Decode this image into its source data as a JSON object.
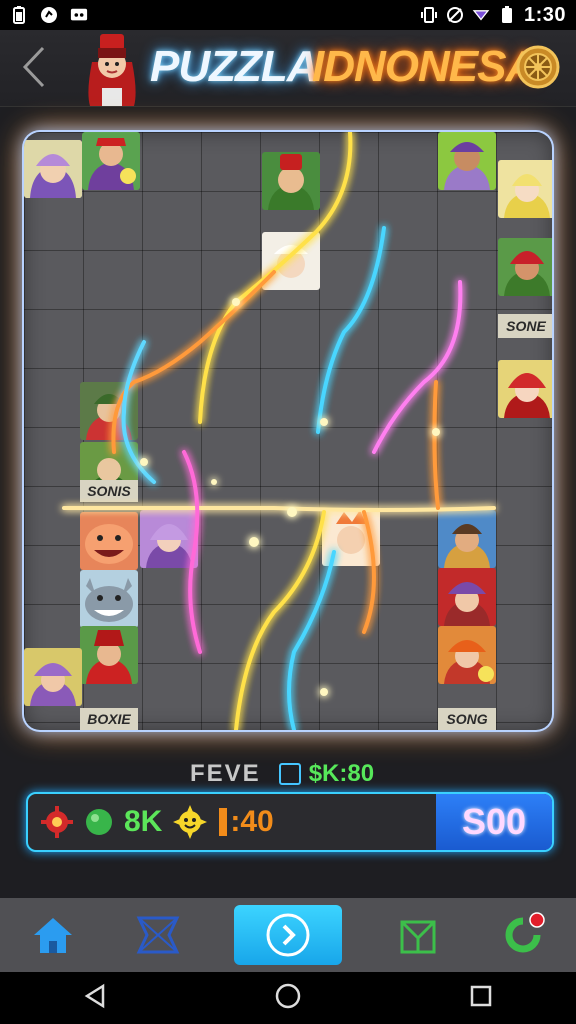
{
  "status_bar": {
    "time": "1:30",
    "left_icons": [
      "battery-icon",
      "app-notification-icon",
      "message-notification-icon"
    ],
    "right_icons": [
      "vibrate-icon",
      "no-sim-icon",
      "wifi-icon",
      "battery-icon"
    ]
  },
  "header": {
    "title_left": "PUZZLA",
    "title_right": "IDNONESA",
    "back_icon": "back-chevron-icon",
    "settings_icon": "settings-wheel-icon",
    "title_left_color": "#eef7ff",
    "title_right_color": "#ffb84a"
  },
  "board": {
    "frame_glow": "#7fb5ff",
    "tile_labels": [
      "SONE",
      "SONIS",
      "BOXIE",
      "SONG"
    ]
  },
  "score": {
    "label": "FEVE",
    "value": "$K:80"
  },
  "panel": {
    "stat_green": "8K",
    "stat_orange": ":40",
    "button_label": "S00",
    "icons": [
      "red-gear-icon",
      "green-ball-icon",
      "sun-face-icon",
      "orange-bar-icon"
    ]
  },
  "bottom_nav": {
    "items": [
      "home-icon",
      "puzzle-frame-icon",
      "play-arrow-icon",
      "box-icon",
      "refresh-icon"
    ],
    "active": "play-arrow-icon",
    "accent": "#24b5f5"
  },
  "system_nav": {
    "items": [
      "back-triangle-icon",
      "home-circle-icon",
      "recents-square-icon"
    ]
  }
}
